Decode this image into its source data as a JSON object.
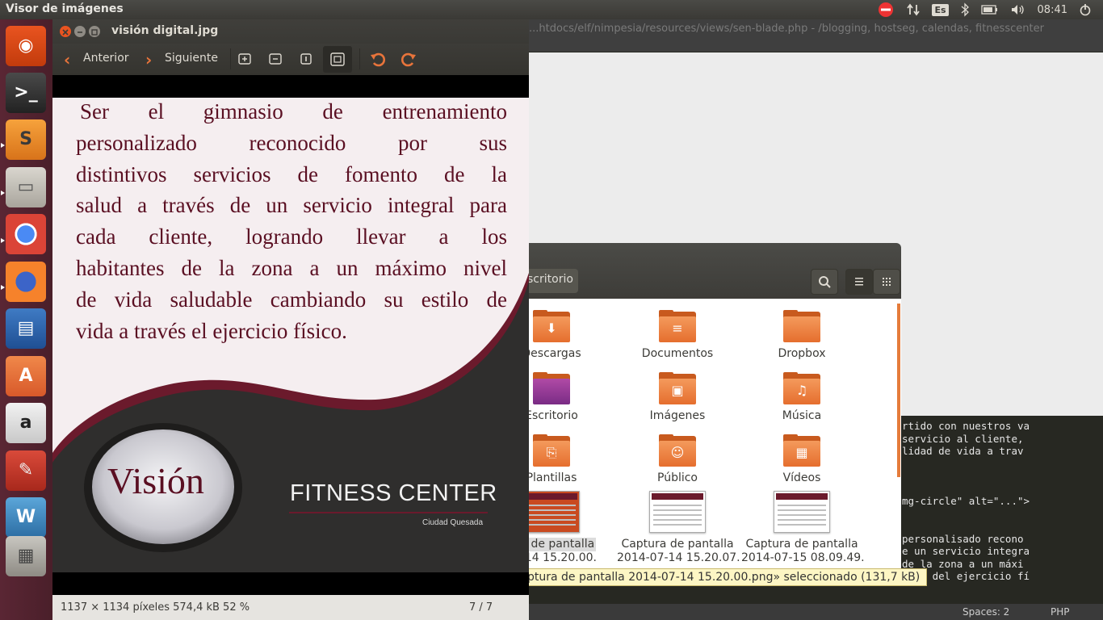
{
  "top_panel": {
    "app_title": "Visor de imágenes",
    "keyboard_layout": "Es",
    "clock": "08:41",
    "indicators": [
      "do-not-disturb-icon",
      "network-icon",
      "keyboard-icon",
      "bluetooth-icon",
      "battery-icon",
      "volume-icon",
      "power-icon"
    ]
  },
  "launcher": {
    "items": [
      "ubuntu-dash",
      "terminal",
      "sublime-text",
      "files",
      "chrome",
      "firefox",
      "writer",
      "software-center",
      "amazon",
      "system-settings",
      "mysql-workbench",
      "workspaces"
    ]
  },
  "background_editor": {
    "tab_path": "...htdocs/elf/nimpesia/resources/views/sen-blade.php - /blogging, hostseg, calendas, fitnesscenter",
    "code_lines": [
      "rtido con nuestros va",
      "servicio al cliente,",
      "lidad de vida a trav",
      "",
      "",
      "",
      "mg-circle\" alt=\"...\">",
      "",
      "",
      "personalisado recono",
      "e un servicio integra",
      "de la zona a un máxi",
      "avés del ejercicio fí"
    ],
    "status": {
      "spaces": "Spaces: 2",
      "syntax": "PHP"
    }
  },
  "files": {
    "path": "scritorio",
    "items": [
      {
        "label": "Descargas",
        "kind": "folder",
        "glyph": "⬇"
      },
      {
        "label": "Documentos",
        "kind": "folder",
        "glyph": "≡"
      },
      {
        "label": "Dropbox",
        "kind": "folder",
        "glyph": ""
      },
      {
        "label": "Escritorio",
        "kind": "folder-purple",
        "glyph": ""
      },
      {
        "label": "Imágenes",
        "kind": "folder",
        "glyph": "▣"
      },
      {
        "label": "Música",
        "kind": "folder",
        "glyph": "♫"
      },
      {
        "label": "Plantillas",
        "kind": "folder",
        "glyph": "⎘"
      },
      {
        "label": "Público",
        "kind": "folder",
        "glyph": "☺"
      },
      {
        "label": "Vídeos",
        "kind": "folder",
        "glyph": "▦"
      },
      {
        "label": "ura de pantalla",
        "label2": "07-14 15.20.00.",
        "kind": "thumb-selected"
      },
      {
        "label": "Captura de pantalla",
        "label2": "2014-07-14 15.20.07.",
        "kind": "thumb"
      },
      {
        "label": "Captura de pantalla",
        "label2": "2014-07-15 08.09.49.",
        "kind": "thumb"
      }
    ],
    "status": "ptura de pantalla 2014-07-14 15.20.00.png» seleccionado  (131,7 kB)"
  },
  "viewer": {
    "title": "visión digital.jpg",
    "toolbar": {
      "prev_label": "Anterior",
      "next_label": "Siguiente"
    },
    "image": {
      "vision_lines": [
        "Ser el gimnasio de entrenamiento",
        "personalizado reconocido por sus",
        "distintivos servicios de fomento de la",
        "salud a través de un servicio integral para",
        "cada cliente, logrando llevar a los",
        "habitantes de la zona a un máximo nivel",
        "de vida saludable cambiando su estilo de",
        "vida a través el ejercicio físico."
      ],
      "badge_word": "Visión",
      "brand": "FITNESS CENTER",
      "location": "Ciudad Quesada"
    },
    "status": {
      "info": "1137 × 1134 píxeles  574,4 kB   52 %",
      "page": "7 / 7"
    }
  },
  "colors": {
    "launcher_bg": "#5a2634",
    "accent_orange": "#e8743b",
    "vision_maroon": "#5a0f22"
  }
}
